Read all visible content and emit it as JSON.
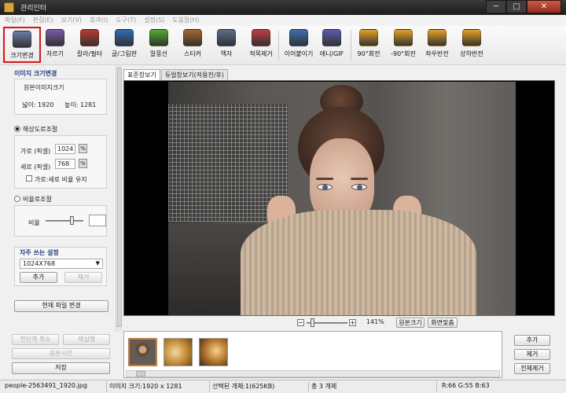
{
  "window": {
    "title": "관리인터",
    "controls": {
      "minimize": "─",
      "maximize": "□",
      "close": "✕"
    }
  },
  "menu": [
    "파일(F)",
    "편집(E)",
    "보기(V)",
    "효과(I)",
    "도구(T)",
    "설정(S)",
    "도움말(H)"
  ],
  "toolbar": [
    {
      "label": "크기변경",
      "icon": "resize-icon",
      "color": "#6b7fa8",
      "active": true
    },
    {
      "label": "자르기",
      "icon": "crop-icon",
      "color": "#7b5aa8",
      "active": false
    },
    {
      "label": "칼라/필터",
      "icon": "color-filter-icon",
      "color": "#c0392b",
      "active": false
    },
    {
      "label": "글/그림판",
      "icon": "text-paint-icon",
      "color": "#2c6cb8",
      "active": false
    },
    {
      "label": "말풍선",
      "icon": "speech-bubble-icon",
      "color": "#4caf2a",
      "active": false
    },
    {
      "label": "스티커",
      "icon": "sticker-icon",
      "color": "#a8662a",
      "active": false
    },
    {
      "label": "액자",
      "icon": "frame-icon",
      "color": "#5a6e8c",
      "active": false
    },
    {
      "label": "적목제거",
      "icon": "red-eye-icon",
      "color": "#c43a3a",
      "active": false
    },
    {
      "label": "이어붙이기",
      "icon": "merge-icon",
      "color": "#3a6fb0",
      "active": false
    },
    {
      "label": "애니/GIF",
      "icon": "gif-icon",
      "color": "#5a5ab0",
      "active": false
    },
    {
      "label": "90°회전",
      "icon": "rotate-right-icon",
      "color": "#e7a21e",
      "active": false
    },
    {
      "label": "-90°회전",
      "icon": "rotate-left-icon",
      "color": "#e7a21e",
      "active": false
    },
    {
      "label": "좌우반전",
      "icon": "flip-horizontal-icon",
      "color": "#e7a21e",
      "active": false
    },
    {
      "label": "상하반전",
      "icon": "flip-vertical-icon",
      "color": "#e7a21e",
      "active": false
    }
  ],
  "left": {
    "section_title": "이미지 크기변경",
    "original_label": "원본이미지크기",
    "orig_width": "넓이: 1920",
    "orig_height": "높이:  1281",
    "mode_resolution": "해상도로조절",
    "width_label": "가로 (픽셀)",
    "width_value": "1024",
    "height_label": "세로 (픽셀)",
    "height_value": "768",
    "keep_ratio_label": "가로:세로 비율 유지",
    "mode_ratio": "비율로조절",
    "ratio_label": "비율",
    "presets_title": "자주 쓰는 설정",
    "preset_value": "1024X768",
    "add_button": "추가",
    "remove_button": "제거",
    "apply_button": "현재 파일 변경",
    "undo_button": "한단계 취소",
    "redo_button": "재실행",
    "original_button": "원본사진",
    "save_button": "저장"
  },
  "viewer": {
    "tabs": [
      "표준창보기",
      "듀얼창보기(적용전/후)"
    ],
    "zoom": "141%",
    "zoom_minus": "−",
    "zoom_plus": "+",
    "original_size_button": "원본크기",
    "fit_screen_button": "화면맞춤"
  },
  "thumbs": {
    "add": "추가",
    "remove": "제거",
    "remove_all": "전체제거"
  },
  "status": {
    "filename": "people-2563491_1920.jpg",
    "image_size": "이미지 크기:1920 x 1281",
    "selected": "선택된 개체:1(625KB)",
    "total": "총 3 개체",
    "pixel": "R:66 G:55 B:63"
  }
}
